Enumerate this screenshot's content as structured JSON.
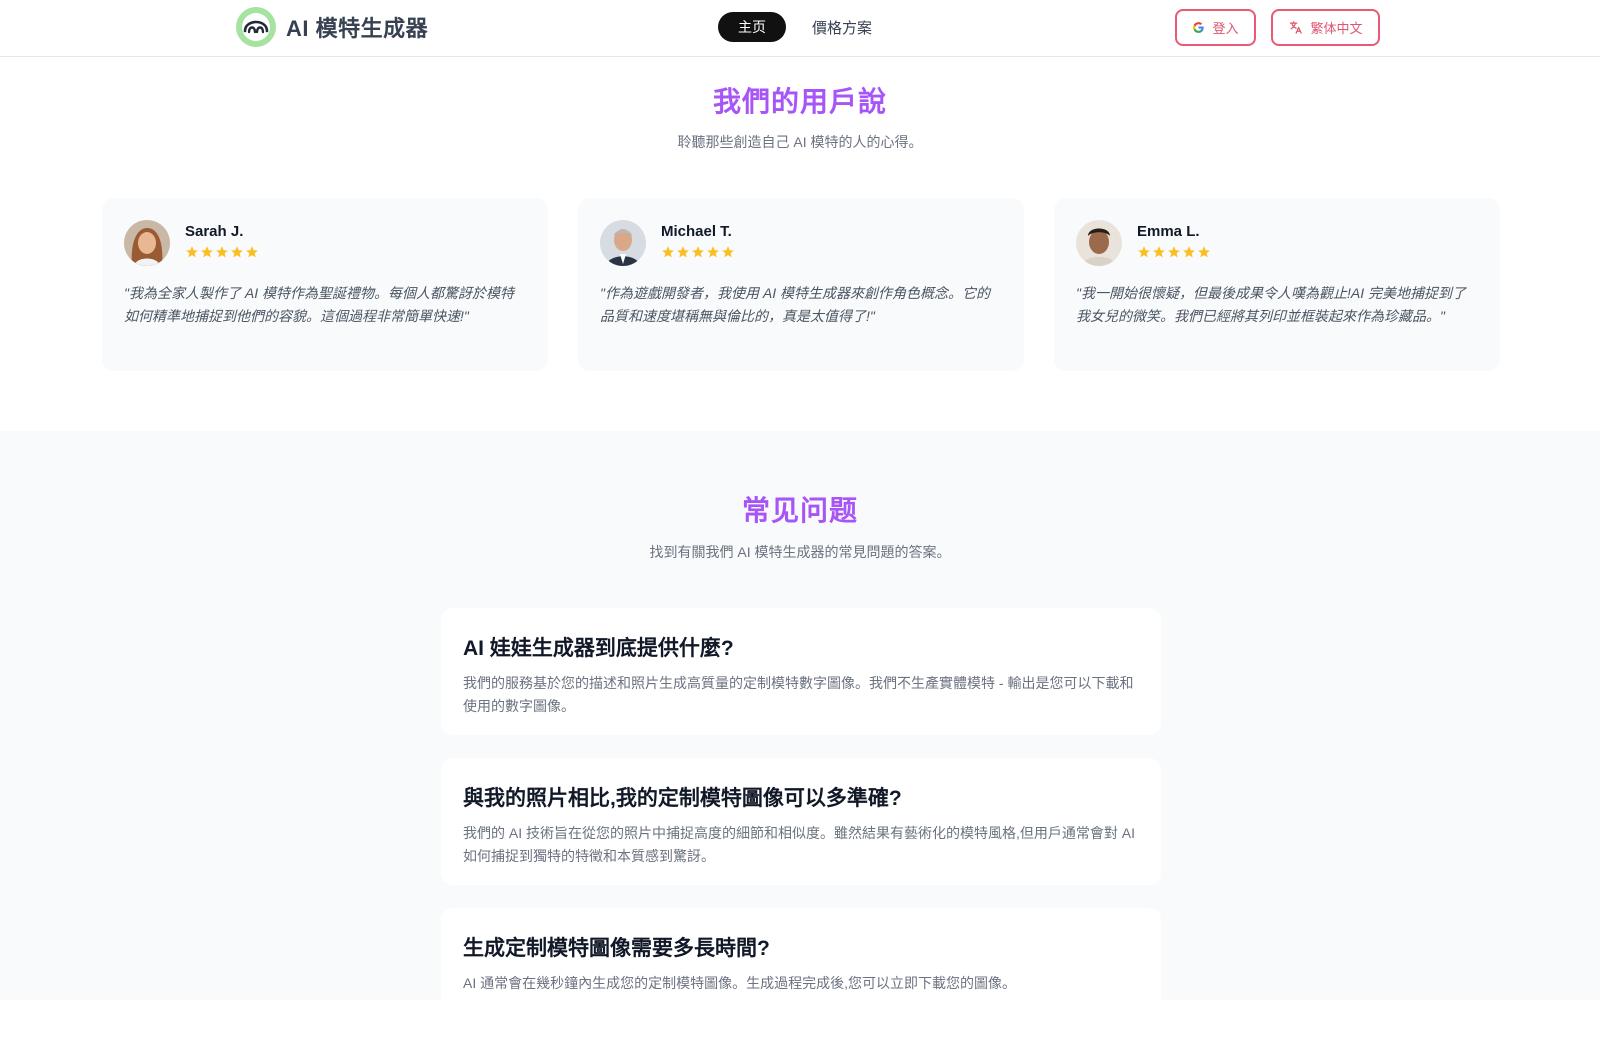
{
  "header": {
    "app_name": "AI 模特生成器",
    "nav": {
      "home": "主页",
      "pricing": "價格方案"
    },
    "login_label": "登入",
    "language_label": "繁体中文"
  },
  "testimonials": {
    "title": "我們的用戶說",
    "subtitle": "聆聽那些創造自己 AI 模特的人的心得。",
    "items": [
      {
        "name": "Sarah J.",
        "rating": 5,
        "quote": "\"我為全家人製作了 AI 模特作為聖誕禮物。每個人都驚訝於模特如何精準地捕捉到他們的容貌。這個過程非常簡單快速!\""
      },
      {
        "name": "Michael T.",
        "rating": 5,
        "quote": "\"作為遊戲開發者，我使用 AI 模特生成器來創作角色概念。它的品質和速度堪稱無與倫比的，真是太值得了!\""
      },
      {
        "name": "Emma L.",
        "rating": 5,
        "quote": "\"我一開始很懷疑，但最後成果令人嘆為觀止!AI 完美地捕捉到了我女兒的微笑。我們已經將其列印並框裝起來作為珍藏品。\""
      }
    ]
  },
  "faq": {
    "title": "常见问题",
    "subtitle": "找到有關我們 AI 模特生成器的常見問題的答案。",
    "items": [
      {
        "q": "AI 娃娃生成器到底提供什麼?",
        "a": "我們的服務基於您的描述和照片生成高質量的定制模特數字圖像。我們不生產實體模特 - 輸出是您可以下載和使用的數字圖像。"
      },
      {
        "q": "與我的照片相比,我的定制模特圖像可以多準確?",
        "a": "我們的 AI 技術旨在從您的照片中捕捉高度的細節和相似度。雖然結果有藝術化的模特風格,但用戶通常會對 AI 如何捕捉到獨特的特徵和本質感到驚訝。"
      },
      {
        "q": "生成定制模特圖像需要多長時間?",
        "a": "AI 通常會在幾秒鐘內生成您的定制模特圖像。生成過程完成後,您可以立即下載您的圖像。"
      }
    ]
  },
  "colors": {
    "accent": "#a855f7",
    "star": "#fbbf24",
    "button_border": "#e95b74"
  }
}
